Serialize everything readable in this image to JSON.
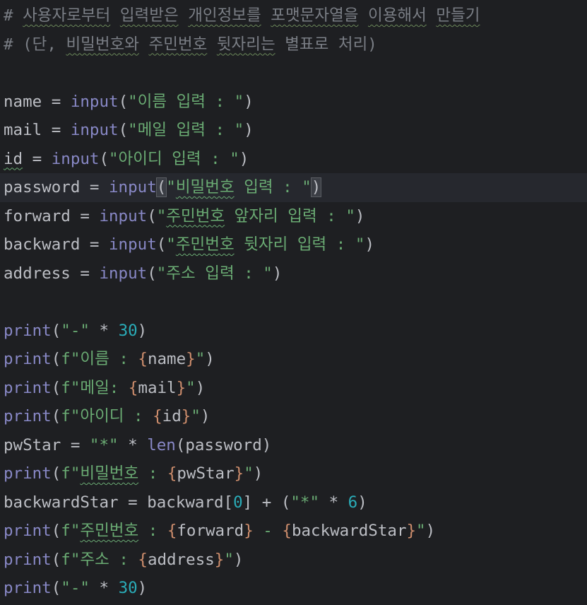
{
  "editor": {
    "lines": [
      {
        "tokens": [
          {
            "t": "# ",
            "c": "comment"
          },
          {
            "t": "사용자로부터",
            "c": "comment typo-c"
          },
          {
            "t": " ",
            "c": "comment"
          },
          {
            "t": "입력받은",
            "c": "comment typo-c"
          },
          {
            "t": " ",
            "c": "comment"
          },
          {
            "t": "개인정보를",
            "c": "comment typo-c"
          },
          {
            "t": " ",
            "c": "comment"
          },
          {
            "t": "포맷문자열을",
            "c": "comment typo-c"
          },
          {
            "t": " ",
            "c": "comment"
          },
          {
            "t": "이용해서",
            "c": "comment typo-c"
          },
          {
            "t": " ",
            "c": "comment"
          },
          {
            "t": "만들기",
            "c": "comment typo-c"
          }
        ]
      },
      {
        "tokens": [
          {
            "t": "# (단, ",
            "c": "comment"
          },
          {
            "t": "비밀번호와",
            "c": "comment typo-c"
          },
          {
            "t": " ",
            "c": "comment"
          },
          {
            "t": "주민번호",
            "c": "comment typo-c"
          },
          {
            "t": " ",
            "c": "comment"
          },
          {
            "t": "뒷자리는",
            "c": "comment typo-c"
          },
          {
            "t": " ",
            "c": "comment"
          },
          {
            "t": "별표로",
            "c": "comment"
          },
          {
            "t": " 처리)",
            "c": "comment"
          }
        ]
      },
      {
        "tokens": []
      },
      {
        "tokens": [
          {
            "t": "name = ",
            "c": ""
          },
          {
            "t": "input",
            "c": "builtin"
          },
          {
            "t": "(",
            "c": ""
          },
          {
            "t": "\"이름 입력 : \"",
            "c": "str"
          },
          {
            "t": ")",
            "c": ""
          }
        ]
      },
      {
        "tokens": [
          {
            "t": "mail = ",
            "c": ""
          },
          {
            "t": "input",
            "c": "builtin"
          },
          {
            "t": "(",
            "c": ""
          },
          {
            "t": "\"메일 입력 : \"",
            "c": "str"
          },
          {
            "t": ")",
            "c": ""
          }
        ]
      },
      {
        "tokens": [
          {
            "t": "id",
            "c": "typo-p"
          },
          {
            "t": " = ",
            "c": ""
          },
          {
            "t": "input",
            "c": "builtin"
          },
          {
            "t": "(",
            "c": ""
          },
          {
            "t": "\"아이디 입력 : \"",
            "c": "str"
          },
          {
            "t": ")",
            "c": ""
          }
        ]
      },
      {
        "current": true,
        "tokens": [
          {
            "t": "password = ",
            "c": ""
          },
          {
            "t": "input",
            "c": "builtin"
          },
          {
            "t": "(",
            "c": "brmatch"
          },
          {
            "t": "\"",
            "c": "str"
          },
          {
            "t": "비밀번호",
            "c": "str typo"
          },
          {
            "t": " 입력 : \"",
            "c": "str"
          },
          {
            "t": ")",
            "c": "brmatch"
          }
        ]
      },
      {
        "tokens": [
          {
            "t": "forward = ",
            "c": ""
          },
          {
            "t": "input",
            "c": "builtin"
          },
          {
            "t": "(",
            "c": ""
          },
          {
            "t": "\"",
            "c": "str"
          },
          {
            "t": "주민번호",
            "c": "str typo"
          },
          {
            "t": " 앞자리 입력 : \"",
            "c": "str"
          },
          {
            "t": ")",
            "c": ""
          }
        ]
      },
      {
        "tokens": [
          {
            "t": "backward = ",
            "c": ""
          },
          {
            "t": "input",
            "c": "builtin"
          },
          {
            "t": "(",
            "c": ""
          },
          {
            "t": "\"",
            "c": "str"
          },
          {
            "t": "주민번호",
            "c": "str typo"
          },
          {
            "t": " 뒷자리 입력 : \"",
            "c": "str"
          },
          {
            "t": ")",
            "c": ""
          }
        ]
      },
      {
        "tokens": [
          {
            "t": "address = ",
            "c": ""
          },
          {
            "t": "input",
            "c": "builtin"
          },
          {
            "t": "(",
            "c": ""
          },
          {
            "t": "\"주소 입력 : \"",
            "c": "str"
          },
          {
            "t": ")",
            "c": ""
          }
        ]
      },
      {
        "tokens": []
      },
      {
        "tokens": [
          {
            "t": "print",
            "c": "builtin"
          },
          {
            "t": "(",
            "c": ""
          },
          {
            "t": "\"-\"",
            "c": "str"
          },
          {
            "t": " * ",
            "c": ""
          },
          {
            "t": "30",
            "c": "num"
          },
          {
            "t": ")",
            "c": ""
          }
        ]
      },
      {
        "tokens": [
          {
            "t": "print",
            "c": "builtin"
          },
          {
            "t": "(",
            "c": ""
          },
          {
            "t": "f\"이름 : ",
            "c": "str"
          },
          {
            "t": "{",
            "c": "brace"
          },
          {
            "t": "name",
            "c": "fvar"
          },
          {
            "t": "}",
            "c": "brace"
          },
          {
            "t": "\"",
            "c": "str"
          },
          {
            "t": ")",
            "c": ""
          }
        ]
      },
      {
        "tokens": [
          {
            "t": "print",
            "c": "builtin"
          },
          {
            "t": "(",
            "c": ""
          },
          {
            "t": "f\"메일: ",
            "c": "str"
          },
          {
            "t": "{",
            "c": "brace"
          },
          {
            "t": "mail",
            "c": "fvar"
          },
          {
            "t": "}",
            "c": "brace"
          },
          {
            "t": "\"",
            "c": "str"
          },
          {
            "t": ")",
            "c": ""
          }
        ]
      },
      {
        "tokens": [
          {
            "t": "print",
            "c": "builtin"
          },
          {
            "t": "(",
            "c": ""
          },
          {
            "t": "f\"아이디 : ",
            "c": "str"
          },
          {
            "t": "{",
            "c": "brace"
          },
          {
            "t": "id",
            "c": "fvar"
          },
          {
            "t": "}",
            "c": "brace"
          },
          {
            "t": "\"",
            "c": "str"
          },
          {
            "t": ")",
            "c": ""
          }
        ]
      },
      {
        "tokens": [
          {
            "t": "pwStar = ",
            "c": ""
          },
          {
            "t": "\"*\"",
            "c": "str"
          },
          {
            "t": " * ",
            "c": ""
          },
          {
            "t": "len",
            "c": "builtin"
          },
          {
            "t": "(password)",
            "c": ""
          }
        ]
      },
      {
        "tokens": [
          {
            "t": "print",
            "c": "builtin"
          },
          {
            "t": "(",
            "c": ""
          },
          {
            "t": "f\"",
            "c": "str"
          },
          {
            "t": "비밀번호",
            "c": "str typo"
          },
          {
            "t": " : ",
            "c": "str"
          },
          {
            "t": "{",
            "c": "brace"
          },
          {
            "t": "pwStar",
            "c": "fvar"
          },
          {
            "t": "}",
            "c": "brace"
          },
          {
            "t": "\"",
            "c": "str"
          },
          {
            "t": ")",
            "c": ""
          }
        ]
      },
      {
        "tokens": [
          {
            "t": "backwardStar = backward[",
            "c": ""
          },
          {
            "t": "0",
            "c": "num"
          },
          {
            "t": "] + (",
            "c": ""
          },
          {
            "t": "\"*\"",
            "c": "str"
          },
          {
            "t": " * ",
            "c": ""
          },
          {
            "t": "6",
            "c": "num"
          },
          {
            "t": ")",
            "c": ""
          }
        ]
      },
      {
        "tokens": [
          {
            "t": "print",
            "c": "builtin"
          },
          {
            "t": "(",
            "c": ""
          },
          {
            "t": "f\"",
            "c": "str"
          },
          {
            "t": "주민번호",
            "c": "str typo"
          },
          {
            "t": " : ",
            "c": "str"
          },
          {
            "t": "{",
            "c": "brace"
          },
          {
            "t": "forward",
            "c": "fvar"
          },
          {
            "t": "}",
            "c": "brace"
          },
          {
            "t": " - ",
            "c": "str"
          },
          {
            "t": "{",
            "c": "brace"
          },
          {
            "t": "backwardStar",
            "c": "fvar"
          },
          {
            "t": "}",
            "c": "brace"
          },
          {
            "t": "\"",
            "c": "str"
          },
          {
            "t": ")",
            "c": ""
          }
        ]
      },
      {
        "tokens": [
          {
            "t": "print",
            "c": "builtin"
          },
          {
            "t": "(",
            "c": ""
          },
          {
            "t": "f\"주소 : ",
            "c": "str"
          },
          {
            "t": "{",
            "c": "brace"
          },
          {
            "t": "address",
            "c": "fvar"
          },
          {
            "t": "}",
            "c": "brace"
          },
          {
            "t": "\"",
            "c": "str"
          },
          {
            "t": ")",
            "c": ""
          }
        ]
      },
      {
        "tokens": [
          {
            "t": "print",
            "c": "builtin"
          },
          {
            "t": "(",
            "c": ""
          },
          {
            "t": "\"-\"",
            "c": "str"
          },
          {
            "t": " * ",
            "c": ""
          },
          {
            "t": "30",
            "c": "num"
          },
          {
            "t": ")",
            "c": ""
          }
        ]
      }
    ]
  }
}
